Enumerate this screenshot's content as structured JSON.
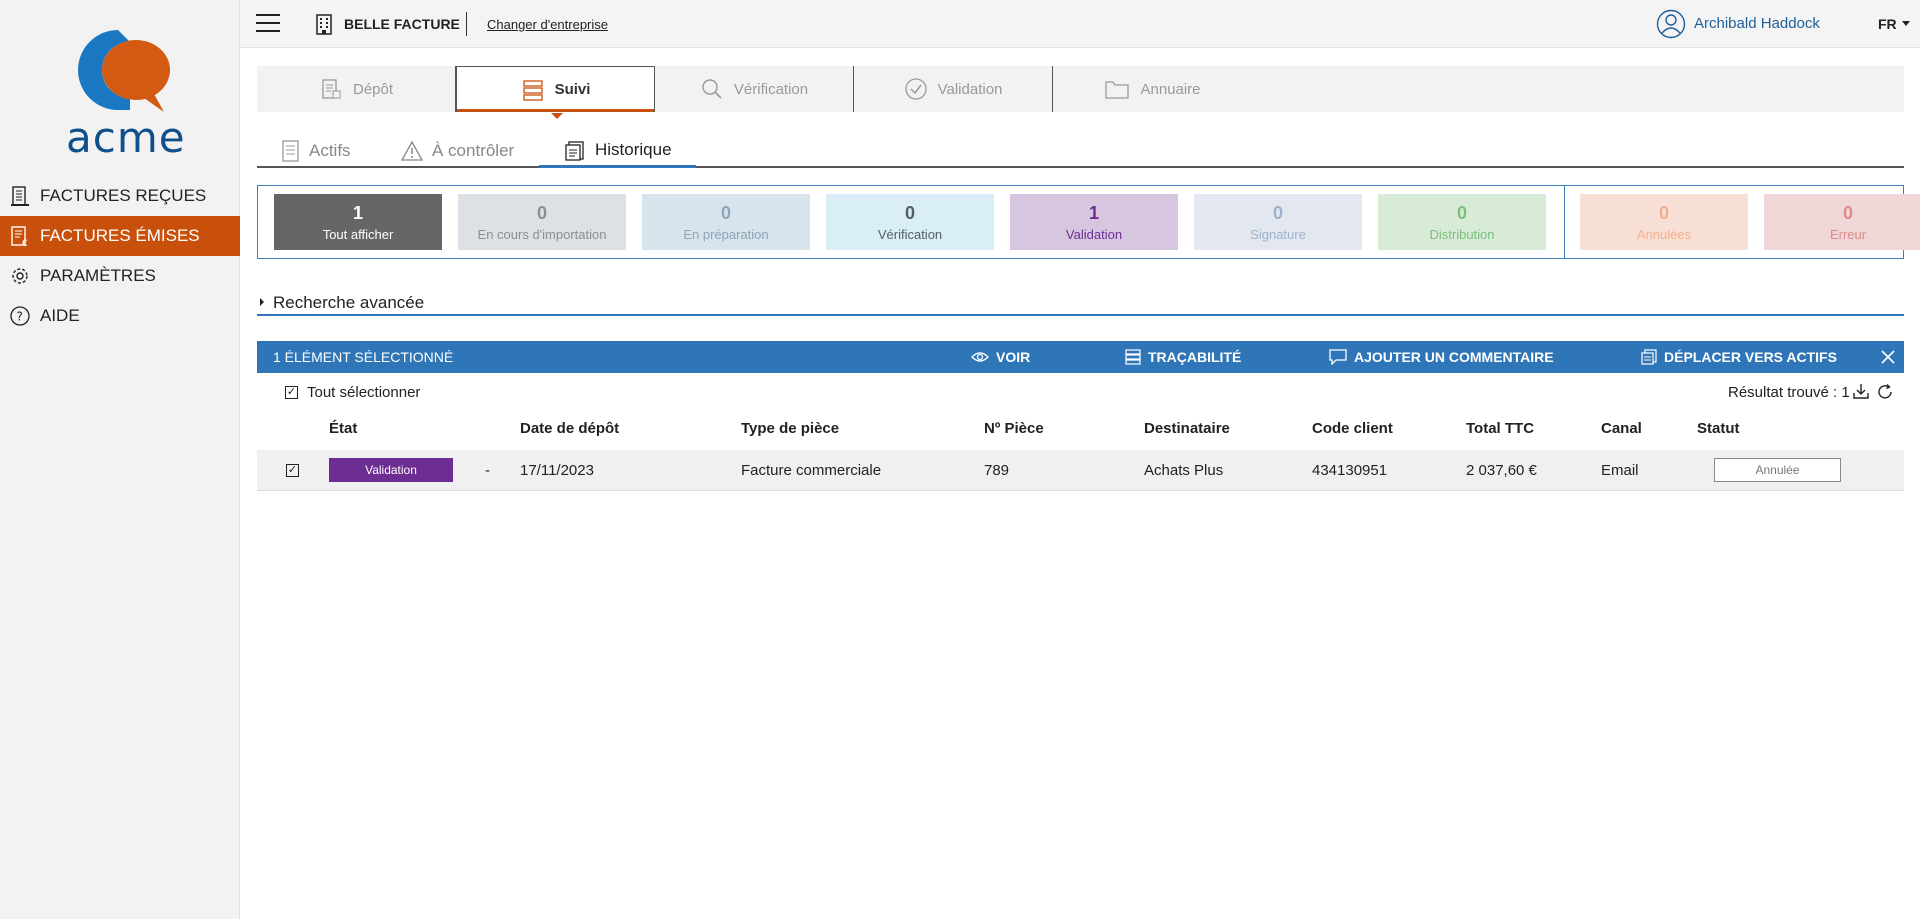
{
  "sidebar": {
    "logo_text": "acme",
    "items": [
      {
        "label": "FACTURES REÇUES",
        "icon": "building-icon"
      },
      {
        "label": "FACTURES ÉMISES",
        "icon": "invoice-euro-icon"
      },
      {
        "label": "PARAMÈTRES",
        "icon": "gear-icon"
      },
      {
        "label": "AIDE",
        "icon": "help-icon"
      }
    ]
  },
  "topbar": {
    "company": "BELLE FACTURE",
    "change_company": "Changer d'entreprise",
    "username": "Archibald Haddock",
    "language": "FR"
  },
  "main_tabs": [
    {
      "label": "Dépôt",
      "icon": "document-upload-icon"
    },
    {
      "label": "Suivi",
      "icon": "list-icon"
    },
    {
      "label": "Vérification",
      "icon": "search-icon"
    },
    {
      "label": "Validation",
      "icon": "check-circle-icon"
    },
    {
      "label": "Annuaire",
      "icon": "folder-icon"
    }
  ],
  "sub_tabs": [
    {
      "label": "Actifs",
      "icon": "document-icon"
    },
    {
      "label": "À contrôler",
      "icon": "warning-icon"
    },
    {
      "label": "Historique",
      "icon": "history-icon"
    }
  ],
  "counters": [
    {
      "count": "1",
      "label": "Tout afficher",
      "bg": "#666666",
      "color": "#ffffff"
    },
    {
      "count": "0",
      "label": "En cours d'importation",
      "bg": "#dde1e5",
      "color": "#8a8f96"
    },
    {
      "count": "0",
      "label": "En préparation",
      "bg": "#d8e4ec",
      "color": "#8ea4b8"
    },
    {
      "count": "0",
      "label": "Vérification",
      "bg": "#d9eef7",
      "color": "#555e66"
    },
    {
      "count": "1",
      "label": "Validation",
      "bg": "#d6c6e0",
      "color": "#6c2e92"
    },
    {
      "count": "0",
      "label": "Signature",
      "bg": "#e2e7f0",
      "color": "#9fb2cc"
    },
    {
      "count": "0",
      "label": "Distribution",
      "bg": "#d7ebd7",
      "color": "#7dbf7d"
    },
    {
      "count": "0",
      "label": "Annulées",
      "bg": "#f9e0d6",
      "color": "#f0b090"
    },
    {
      "count": "0",
      "label": "Erreur",
      "bg": "#f0d6d6",
      "color": "#e08a8a"
    }
  ],
  "advanced_search": "Recherche avancée",
  "actionbar": {
    "selected": "1 ÉLÉMENT SÉLECTIONNÉ",
    "voir": "VOIR",
    "tracabilite": "TRAÇABILITÉ",
    "commentaire": "AJOUTER UN COMMENTAIRE",
    "deplacer": "DÉPLACER VERS ACTIFS"
  },
  "select_all": "Tout sélectionner",
  "result": "Résultat trouvé : 1",
  "table": {
    "headers": [
      "État",
      "Date de dépôt",
      "Type de pièce",
      "Nº Pièce",
      "Destinataire",
      "Code client",
      "Total TTC",
      "Canal",
      "Statut"
    ],
    "rows": [
      {
        "etat": "Validation",
        "dash": "-",
        "date": "17/11/2023",
        "type": "Facture commerciale",
        "numero": "789",
        "destinataire": "Achats Plus",
        "code_client": "434130951",
        "total": "2 037,60 €",
        "canal": "Email",
        "statut": "Annulée"
      }
    ]
  },
  "colors": {
    "brand_orange": "#c8500a",
    "brand_blue": "#2f76b8",
    "validation_purple": "#6c2e92"
  }
}
